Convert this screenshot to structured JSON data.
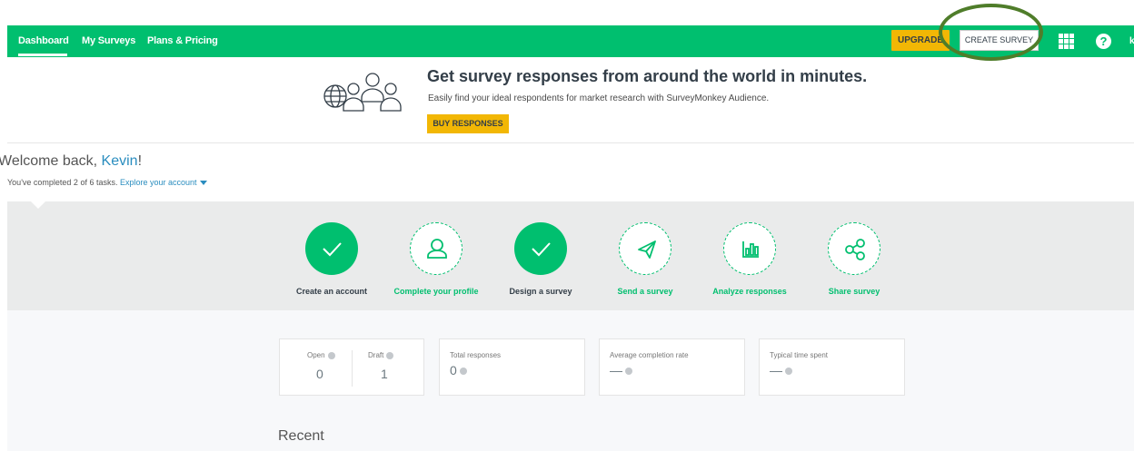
{
  "nav": {
    "dashboard": "Dashboard",
    "my_surveys": "My Surveys",
    "plans": "Plans & Pricing",
    "upgrade": "UPGRADE",
    "create_survey": "CREATE SURVEY",
    "help": "?",
    "user": "kk"
  },
  "banner": {
    "title": "Get survey responses from around the world in minutes.",
    "subtitle": "Easily find your ideal respondents for market research with SurveyMonkey Audience.",
    "button": "BUY RESPONSES"
  },
  "welcome": {
    "prefix": "Welcome back, ",
    "name": "Kevin",
    "suffix": "!",
    "tasks_text": "You've completed 2 of 6 tasks.",
    "explore_link": "Explore your account"
  },
  "steps": [
    {
      "label": "Create an account",
      "done": true,
      "icon": "check-icon"
    },
    {
      "label": "Complete your profile",
      "done": false,
      "icon": "person-icon"
    },
    {
      "label": "Design a survey",
      "done": true,
      "icon": "check-icon"
    },
    {
      "label": "Send a survey",
      "done": false,
      "icon": "paper-plane-icon"
    },
    {
      "label": "Analyze responses",
      "done": false,
      "icon": "bar-chart-icon"
    },
    {
      "label": "Share survey",
      "done": false,
      "icon": "share-icon"
    }
  ],
  "stats": {
    "open_label": "Open",
    "open_value": "0",
    "draft_label": "Draft",
    "draft_value": "1",
    "total_label": "Total responses",
    "total_value": "0",
    "completion_label": "Average completion rate",
    "completion_value": "—",
    "time_label": "Typical time spent",
    "time_value": "—"
  },
  "recent_heading": "Recent",
  "colors": {
    "brand": "#00bf6f",
    "accent": "#f2b705",
    "link": "#2a8dbf"
  }
}
